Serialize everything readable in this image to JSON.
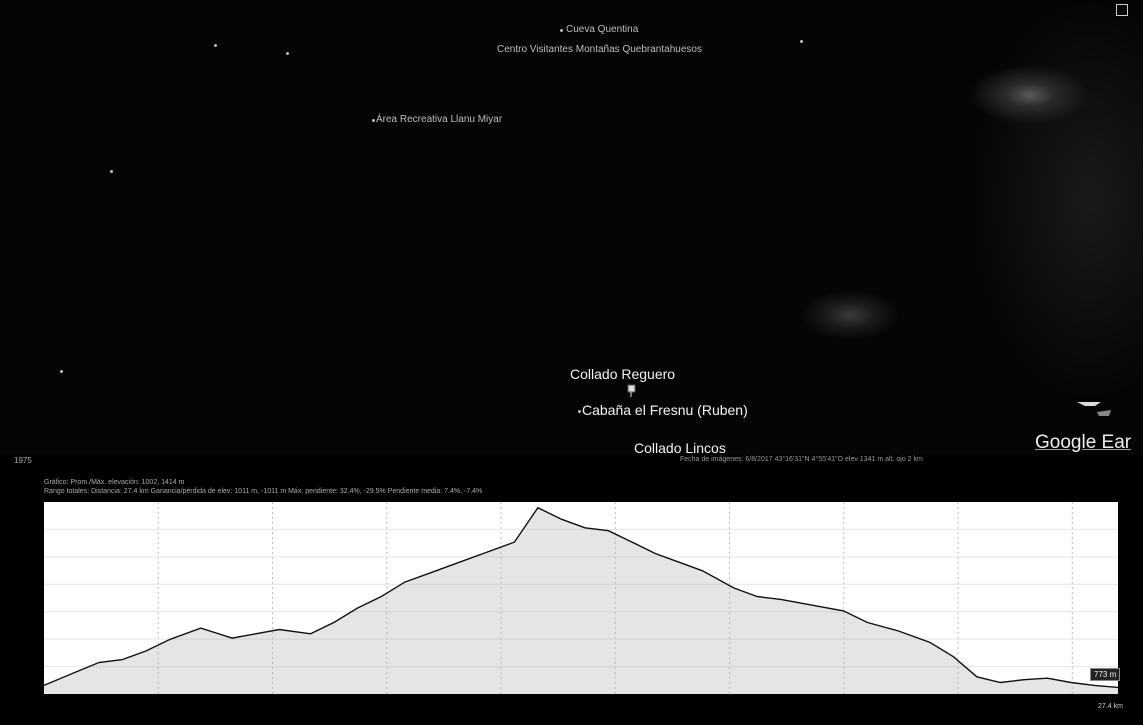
{
  "map": {
    "places": [
      {
        "name": "Cueva Quentina",
        "size": "small"
      },
      {
        "name": "Centro Visitantes Montañas Quebrantahuesos",
        "size": "small"
      },
      {
        "name": "Área Recreativa Llanu Miyar",
        "size": "small"
      },
      {
        "name": "Collado Reguero",
        "size": "big"
      },
      {
        "name": "Cabaña el Fresnu (Ruben)",
        "size": "big"
      },
      {
        "name": "Collado Lincos",
        "size": "big"
      }
    ],
    "logo": "Google Ear"
  },
  "status": {
    "left": "1975",
    "right": "Fecha de imágenes: 6/8/2017   43°16'31\"N  4°55'41\"O   elev 1341 m   alt. ojo 2 km"
  },
  "stats": {
    "line1": "Gráfico: Prom./Máx. elevación: 1002, 1414 m",
    "line2": "Rango totales: Distancia: 27.4 km   Ganancia/pérdida de elev: 1011 m, -1011 m   Máx. pendiente: 32.4%, -29.5%   Pendiente media: 7.4%, -7.4%"
  },
  "profile": {
    "end_label": "773 m",
    "end_distance": "27.4 km"
  },
  "chart_data": {
    "type": "area",
    "x": [
      0,
      0.7,
      1.4,
      2.0,
      2.6,
      3.2,
      4.0,
      4.8,
      5.4,
      6.0,
      6.8,
      7.4,
      8.0,
      8.6,
      9.2,
      10.0,
      10.6,
      11.2,
      12.0,
      12.6,
      13.2,
      13.8,
      14.4,
      15.0,
      15.6,
      16.2,
      16.8,
      17.6,
      18.2,
      18.8,
      19.6,
      20.4,
      21.0,
      21.8,
      22.6,
      23.2,
      23.8,
      24.4,
      25.0,
      25.6,
      26.2,
      26.8,
      27.4
    ],
    "y": [
      780,
      820,
      860,
      870,
      900,
      940,
      980,
      945,
      960,
      975,
      960,
      1000,
      1050,
      1090,
      1140,
      1180,
      1210,
      1240,
      1280,
      1400,
      1360,
      1330,
      1320,
      1280,
      1240,
      1210,
      1180,
      1120,
      1090,
      1080,
      1060,
      1040,
      1000,
      970,
      930,
      880,
      810,
      790,
      800,
      805,
      790,
      780,
      773
    ],
    "ylim": [
      750,
      1420
    ],
    "grid": true
  }
}
